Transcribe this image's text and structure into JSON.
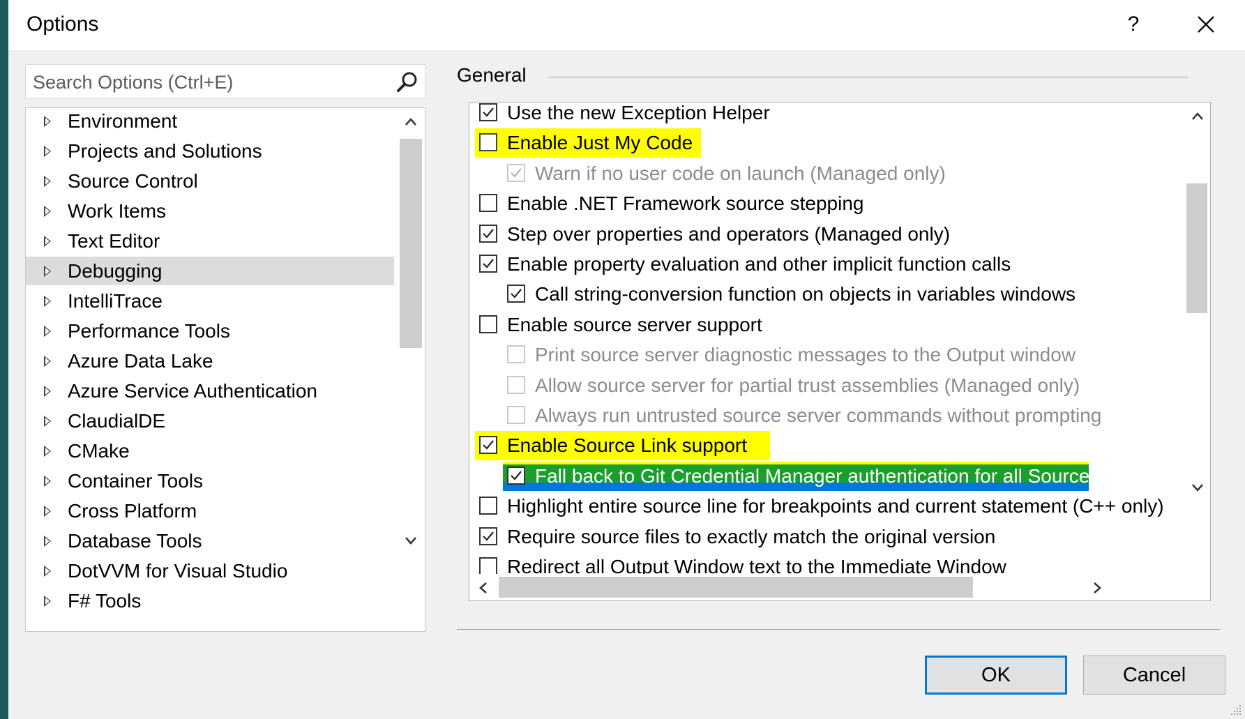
{
  "window": {
    "title": "Options",
    "help_label": "?"
  },
  "search": {
    "placeholder": "Search Options (Ctrl+E)",
    "icon": "search-icon"
  },
  "tree": {
    "items": [
      {
        "label": "Environment"
      },
      {
        "label": "Projects and Solutions"
      },
      {
        "label": "Source Control"
      },
      {
        "label": "Work Items"
      },
      {
        "label": "Text Editor"
      },
      {
        "label": "Debugging",
        "selected": true
      },
      {
        "label": "IntelliTrace"
      },
      {
        "label": "Performance Tools"
      },
      {
        "label": "Azure Data Lake"
      },
      {
        "label": "Azure Service Authentication"
      },
      {
        "label": "ClaudialDE"
      },
      {
        "label": "CMake"
      },
      {
        "label": "Container Tools"
      },
      {
        "label": "Cross Platform"
      },
      {
        "label": "Database Tools"
      },
      {
        "label": "DotVVM for Visual Studio"
      },
      {
        "label": "F# Tools"
      }
    ]
  },
  "general": {
    "title": "General",
    "options": [
      {
        "label": "Use the new Exception Helper",
        "checked": true
      },
      {
        "label": "Enable Just My Code",
        "checked": false,
        "highlight": "yellow"
      },
      {
        "label": "Warn if no user code on launch (Managed only)",
        "checked": true,
        "disabled": true
      },
      {
        "label": "Enable .NET Framework source stepping",
        "checked": false
      },
      {
        "label": "Step over properties and operators (Managed only)",
        "checked": true
      },
      {
        "label": "Enable property evaluation and other implicit function calls",
        "checked": true
      },
      {
        "label": "Call string-conversion function on objects in variables windows",
        "checked": true
      },
      {
        "label": "Enable source server support",
        "checked": false
      },
      {
        "label": "Print source server diagnostic messages to the Output window",
        "checked": false,
        "disabled": true
      },
      {
        "label": "Allow source server for partial trust assemblies (Managed only)",
        "checked": false,
        "disabled": true
      },
      {
        "label": "Always run untrusted source server commands without prompting",
        "checked": false,
        "disabled": true
      },
      {
        "label": "Enable Source Link support",
        "checked": true,
        "highlight": "yellow"
      },
      {
        "label": "Fall back to Git Credential Manager authentication for all Source Link requ",
        "checked": true,
        "highlight": "selected"
      },
      {
        "label": "Highlight entire source line for breakpoints and current statement (C++ only)",
        "checked": false
      },
      {
        "label": "Require source files to exactly match the original version",
        "checked": true
      },
      {
        "label": "Redirect all Output Window text to the Immediate Window",
        "checked": false
      }
    ]
  },
  "buttons": {
    "ok": "OK",
    "cancel": "Cancel"
  },
  "colors": {
    "highlight_yellow": "#ffff00",
    "selection_blue": "#0078d7",
    "selection_green": "#1a9e2c",
    "accent": "#0078d7"
  }
}
